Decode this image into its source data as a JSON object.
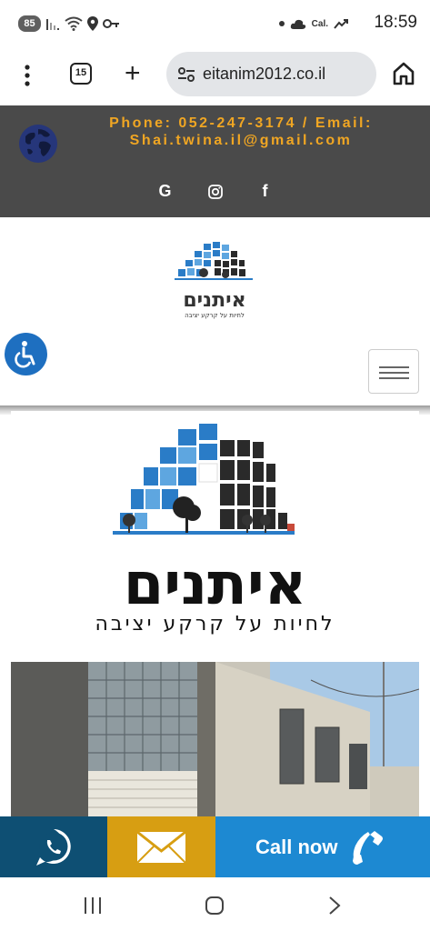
{
  "status_bar": {
    "battery": "85",
    "carrier": "Cal.",
    "time": "18:59",
    "icons": [
      "signal-icon",
      "wifi-icon",
      "location-icon",
      "key-icon",
      "dot-icon",
      "weather-icon",
      "trend-icon"
    ]
  },
  "browser": {
    "url": "eitanim2012.co.il",
    "tab_count": "15",
    "icons": [
      "menu-dots-icon",
      "tabs-icon",
      "plus-icon",
      "site-settings-icon",
      "home-icon"
    ]
  },
  "topbar": {
    "contact_line1": "Phone: 052-247-3174 / Email:",
    "contact_line2": "Shai.twina.il@gmail.com",
    "social": {
      "google": "G",
      "instagram_icon": "instagram-icon",
      "facebook": "f"
    },
    "colors": {
      "background": "#4a4a4a",
      "contact_text": "#f0a623"
    }
  },
  "header": {
    "logo_title": "איתנים",
    "logo_subtitle": "לחיות על קרקע יציבה",
    "accessibility_icon": "wheelchair-icon",
    "menu_icon": "hamburger-icon"
  },
  "main": {
    "brand_title": "איתנים",
    "brand_subtitle": "לחיות על קרקע יציבה"
  },
  "cta": {
    "call_label": "Call now",
    "colors": {
      "whatsapp": "#0e4f73",
      "email": "#d79e12",
      "call": "#1d89d2"
    }
  },
  "navbar": {
    "icons": [
      "recent-apps-icon",
      "home-nav-icon",
      "back-icon"
    ]
  }
}
